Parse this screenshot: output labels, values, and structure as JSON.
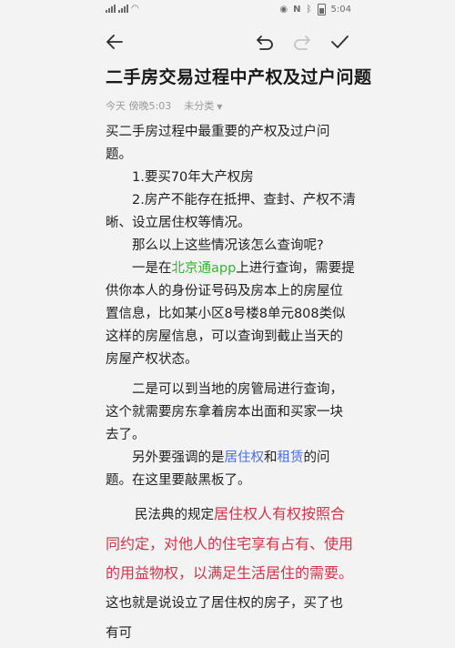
{
  "status_bar": {
    "left_text": "¹⁴⁶ᵢₗ ⁴⁶ᵢₗ",
    "time": "5:04"
  },
  "toolbar": {
    "back_icon": "arrow-left-icon",
    "undo_icon": "undo-icon",
    "redo_icon": "redo-icon",
    "done_icon": "check-icon"
  },
  "note": {
    "title": "二手房交易过程中产权及过户问题",
    "meta_time": "今天 傍晚5:03",
    "meta_category": "未分类",
    "intro": "买二手房过程中最重要的产权及过户问题。",
    "item1": "1.要买70年大产权房",
    "item2": "2.房产不能存在抵押、查封、产权不清晰、设立居住权等情况。",
    "question": "那么以上这些情况该怎么查询呢?",
    "p1_prefix": "一是在",
    "p1_highlight": "北京通app",
    "p1_rest": "上进行查询，需要提供你本人的身份证号码及房本上的房屋位置信息，比如某小区8号楼8单元808类似这样的房屋信息，可以查询到截止当天的房屋产权状态。",
    "p2": "二是可以到当地的房管局进行查询，这个就需要房东拿着房本出面和买家一块去了。",
    "p3_prefix": "另外要强调的是",
    "p3_kw1": "居住权",
    "p3_and": "和",
    "p3_kw2": "租赁",
    "p3_suffix": "的问题。在这里要敲黑板了。",
    "p4_prefix": "民法典的规定",
    "p4_red": "居住权人有权按照合同约定，对他人的住宅享有占有、使用的用益物权，以满足生活居住的需要。",
    "p4_suffix": "这也就是说设立了居住权的房子，买了也有可"
  }
}
